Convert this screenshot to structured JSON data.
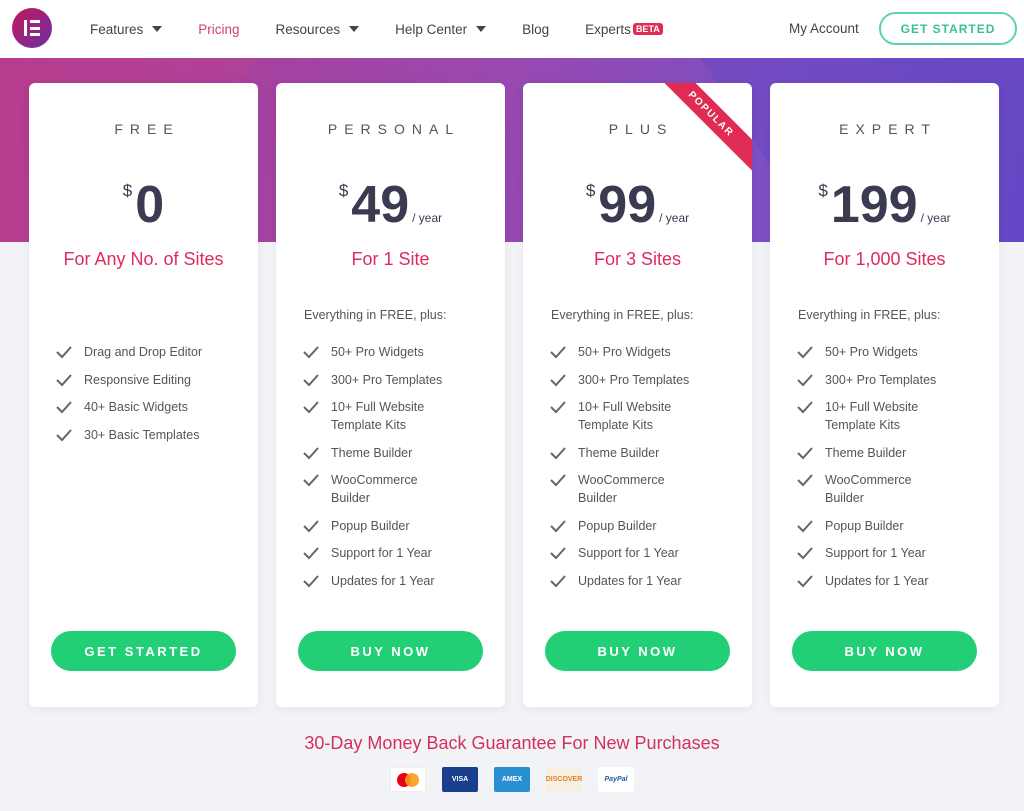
{
  "nav": {
    "items": [
      {
        "label": "Features",
        "caret": true
      },
      {
        "label": "Pricing",
        "active": true
      },
      {
        "label": "Resources",
        "caret": true
      },
      {
        "label": "Help Center",
        "caret": true
      },
      {
        "label": "Blog"
      },
      {
        "label": "Experts",
        "badge": "BETA"
      }
    ],
    "account": "My Account",
    "cta": "GET STARTED"
  },
  "plans": [
    {
      "name": "FREE",
      "currency": "$",
      "price": "0",
      "period": "",
      "sites": "For Any No. of Sites",
      "intro": "",
      "features": [
        "Drag and Drop Editor",
        "Responsive Editing",
        "40+ Basic Widgets",
        "30+ Basic Templates"
      ],
      "button": "GET STARTED"
    },
    {
      "name": "PERSONAL",
      "currency": "$",
      "price": "49",
      "period": "/ year",
      "sites": "For 1 Site",
      "intro": "Everything in FREE, plus:",
      "features": [
        "50+ Pro Widgets",
        "300+ Pro Templates",
        "10+ Full Website Template Kits",
        "Theme Builder",
        "WooCommerce Builder",
        "Popup Builder",
        "Support for 1 Year",
        "Updates for 1 Year"
      ],
      "button": "BUY NOW"
    },
    {
      "name": "PLUS",
      "currency": "$",
      "price": "99",
      "period": "/ year",
      "sites": "For 3 Sites",
      "intro": "Everything in FREE, plus:",
      "ribbon": "POPULAR",
      "features": [
        "50+ Pro Widgets",
        "300+ Pro Templates",
        "10+ Full Website Template Kits",
        "Theme Builder",
        "WooCommerce Builder",
        "Popup Builder",
        "Support for 1 Year",
        "Updates for 1 Year"
      ],
      "button": "BUY NOW"
    },
    {
      "name": "EXPERT",
      "currency": "$",
      "price": "199",
      "period": "/ year",
      "sites": "For 1,000 Sites",
      "intro": "Everything in FREE, plus:",
      "features": [
        "50+ Pro Widgets",
        "300+ Pro Templates",
        "10+ Full Website Template Kits",
        "Theme Builder",
        "WooCommerce Builder",
        "Popup Builder",
        "Support for 1 Year",
        "Updates for 1 Year"
      ],
      "button": "BUY NOW"
    }
  ],
  "guarantee": "30-Day Money Back Guarantee For New Purchases",
  "payments": [
    {
      "name": "mastercard-icon",
      "label": ""
    },
    {
      "name": "visa-icon",
      "label": "VISA"
    },
    {
      "name": "amex-icon",
      "label": "AMEX"
    },
    {
      "name": "discover-icon",
      "label": "DISCOVER"
    },
    {
      "name": "paypal-icon",
      "label": "PayPal"
    }
  ],
  "colors": {
    "accent": "#e02a5c",
    "button": "#22cf77",
    "cta_border": "#5cd6a1"
  }
}
